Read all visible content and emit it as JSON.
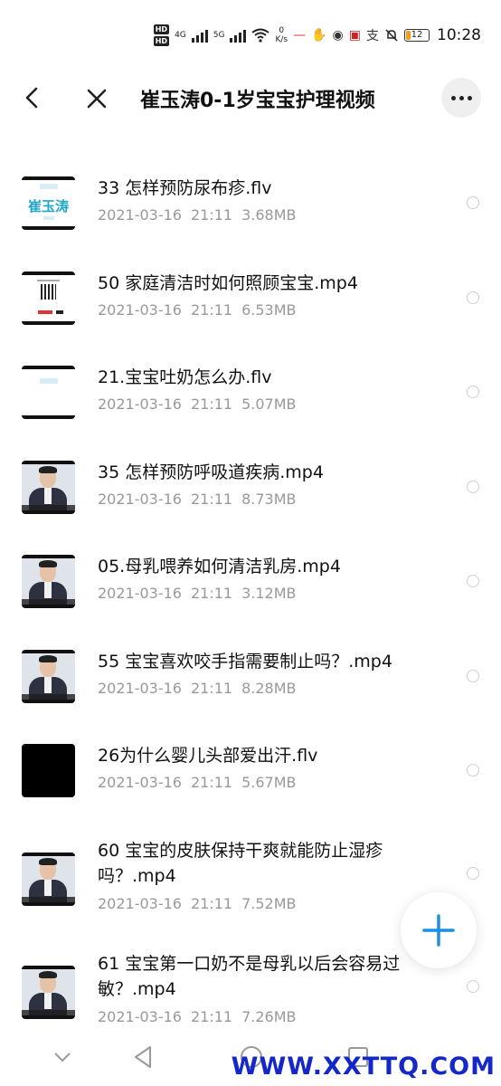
{
  "status_bar": {
    "hd1": "HD",
    "hd2": "HD",
    "sig1_label": "4G",
    "sig2_label": "5G",
    "net_speed_value": "0",
    "net_speed_unit": "K/s",
    "battery": "12",
    "time": "10:28",
    "icons": [
      "hd-icon",
      "signal-icon",
      "wifi-icon",
      "notification-icon",
      "alipay-icon",
      "mute-icon",
      "battery-icon"
    ]
  },
  "header": {
    "title": "崔玉涛0-1岁宝宝护理视频",
    "back_icon": "chevron-left-icon",
    "close_icon": "close-icon",
    "more_icon": "more-dots-icon"
  },
  "files": [
    {
      "name": "33 怎样预防尿布疹.flv",
      "date": "2021-03-16",
      "time": "21:11",
      "size": "3.68MB",
      "thumb": "logo",
      "thumb_text": "崔玉涛"
    },
    {
      "name": "50  家庭清洁时如何照顾宝宝.mp4",
      "date": "2021-03-16",
      "time": "21:11",
      "size": "6.53MB",
      "thumb": "qr"
    },
    {
      "name": "21.宝宝吐奶怎么办.flv",
      "date": "2021-03-16",
      "time": "21:11",
      "size": "5.07MB",
      "thumb": "blank"
    },
    {
      "name": "35 怎样预防呼吸道疾病.mp4",
      "date": "2021-03-16",
      "time": "21:11",
      "size": "8.73MB",
      "thumb": "person"
    },
    {
      "name": "05.母乳喂养如何清洁乳房.mp4",
      "date": "2021-03-16",
      "time": "21:11",
      "size": "3.12MB",
      "thumb": "person"
    },
    {
      "name": "55 宝宝喜欢咬手指需要制止吗？.mp4",
      "date": "2021-03-16",
      "time": "21:11",
      "size": "8.28MB",
      "thumb": "person"
    },
    {
      "name": "26为什么婴儿头部爱出汗.flv",
      "date": "2021-03-16",
      "time": "21:11",
      "size": "5.67MB",
      "thumb": "black"
    },
    {
      "name": "60 宝宝的皮肤保持干爽就能防止湿疹吗？.mp4",
      "date": "2021-03-16",
      "time": "21:11",
      "size": "7.52MB",
      "thumb": "person"
    },
    {
      "name": "61 宝宝第一口奶不是母乳以后会容易过敏？.mp4",
      "date": "2021-03-16",
      "time": "21:11",
      "size": "7.26MB",
      "thumb": "person"
    }
  ],
  "fab": {
    "icon": "plus-icon",
    "color": "#1a8fe3"
  },
  "nav": {
    "icons": [
      "nav-down-icon",
      "nav-back-icon",
      "nav-home-icon",
      "nav-recent-icon"
    ]
  },
  "watermark": "WWW.XXTTQ.COM"
}
